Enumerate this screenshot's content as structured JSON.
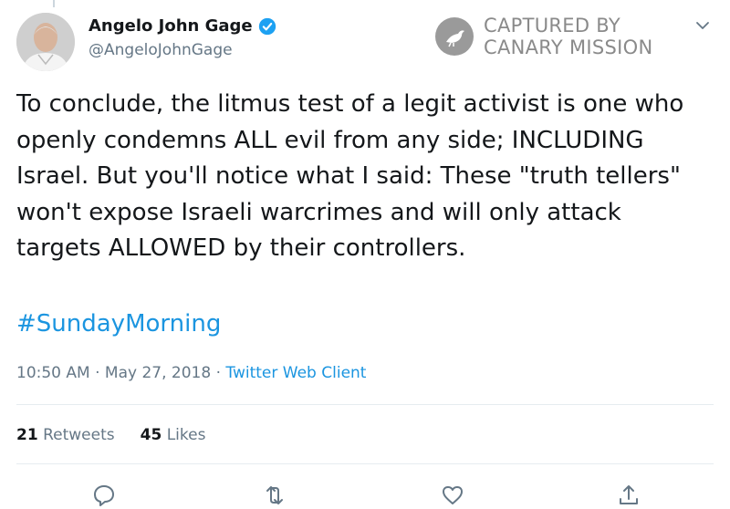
{
  "author": {
    "display_name": "Angelo John Gage",
    "handle": "@AngeloJohnGage",
    "verified": true
  },
  "watermark": {
    "line1": "CAPTURED BY",
    "line2": "CANARY MISSION"
  },
  "tweet": {
    "text": "To conclude, the litmus test of a legit activist is one who\nopenly condemns ALL evil from any side; INCLUDING\nIsrael. But you'll notice what I said: These \"truth tellers\"\nwon't expose Israeli warcrimes and will only attack\ntargets ALLOWED by their controllers.",
    "hashtag": "#SundayMorning",
    "time": "10:50 AM",
    "date": "May 27, 2018",
    "client": "Twitter Web Client"
  },
  "stats": {
    "retweets_count": "21",
    "retweets_label": "Retweets",
    "likes_count": "45",
    "likes_label": "Likes"
  },
  "actions": [
    "reply-icon",
    "retweet-icon",
    "like-icon",
    "share-icon"
  ],
  "colors": {
    "link": "#1b95e0",
    "secondary_text": "#657786",
    "verified": "#1da1f2",
    "watermark": "#8a8a8a"
  }
}
